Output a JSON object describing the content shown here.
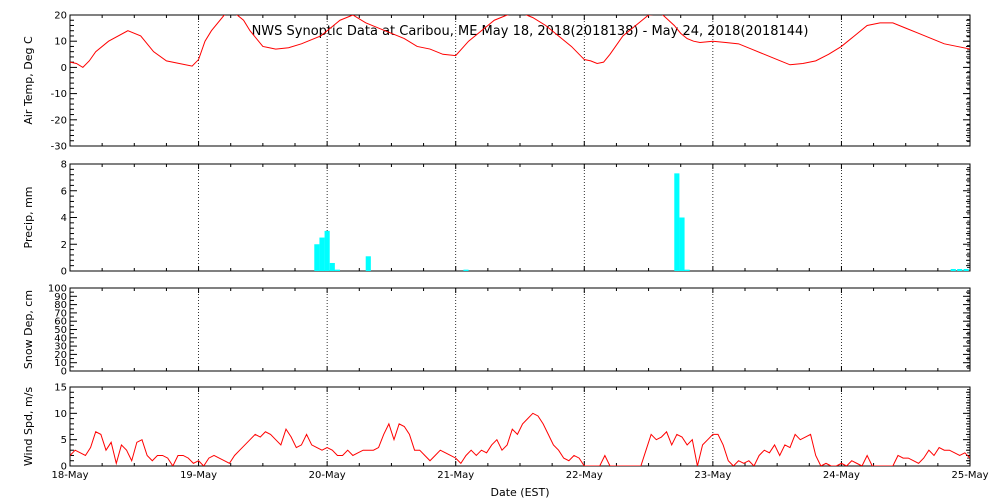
{
  "title": "NWS Synoptic Data at Caribou, ME   May 18, 2018(2018138) - May 24, 2018(2018144)",
  "xlabel": "Date (EST)",
  "colors": {
    "temperature": "#ff0000",
    "precip": "#00ffff",
    "wind": "#ff0000",
    "axis": "#000000",
    "grid": "#000000"
  },
  "chart_data": {
    "type": "multi-panel",
    "x_ticks": [
      "18-May",
      "19-May",
      "20-May",
      "21-May",
      "22-May",
      "23-May",
      "24-May",
      "25-May"
    ],
    "grid": "vertical dotted at day boundaries",
    "panels": [
      {
        "id": "temperature",
        "type": "line",
        "ylabel": "Air Temp, Deg C",
        "ylim": [
          -30,
          20
        ],
        "yticks": [
          "-30",
          "-20",
          "-10",
          "0",
          "10",
          "20"
        ],
        "series": [
          {
            "x": [
              0.0,
              0.05,
              0.1,
              0.15,
              0.2,
              0.3,
              0.45,
              0.55,
              0.65,
              0.75,
              0.85,
              0.95,
              1.0,
              1.05,
              1.1,
              1.2,
              1.25,
              1.3,
              1.35,
              1.4,
              1.5,
              1.55,
              1.6,
              1.7,
              1.8,
              1.9,
              1.95,
              2.0,
              2.05,
              2.1,
              2.15,
              2.2,
              2.3,
              2.45,
              2.6,
              2.7,
              2.8,
              2.9,
              3.0,
              3.1,
              3.15,
              3.2,
              3.25,
              3.3,
              3.4,
              3.5,
              3.6,
              3.7,
              3.8,
              3.9,
              4.0,
              4.05,
              4.1,
              4.15,
              4.2,
              4.3,
              4.4,
              4.5,
              4.6,
              4.7,
              4.75,
              4.8,
              4.85,
              4.9,
              5.0,
              5.1,
              5.2,
              5.3,
              5.4,
              5.5,
              5.6,
              5.7,
              5.8,
              5.9,
              6.0,
              6.05,
              6.1,
              6.15,
              6.2,
              6.3,
              6.4,
              6.5,
              6.6,
              6.7,
              6.8,
              6.9,
              7.0
            ],
            "y": [
              2,
              1.5,
              0,
              2.5,
              6,
              10,
              14,
              12,
              6,
              2.5,
              1.5,
              0.5,
              3,
              10,
              14,
              20,
              21,
              20,
              18,
              14,
              8,
              7.5,
              7,
              7.5,
              9,
              11,
              12,
              14,
              16,
              18,
              19,
              20,
              17,
              14,
              11,
              8,
              7,
              5,
              4.5,
              10,
              12,
              14,
              16,
              18,
              20,
              21,
              19,
              16,
              12,
              8,
              3,
              2.5,
              1.5,
              2,
              5,
              12,
              16,
              20,
              20.5,
              16,
              13,
              11,
              10,
              9.5,
              10,
              9.5,
              9,
              7,
              5,
              3,
              1,
              1.5,
              2.5,
              5,
              8,
              10,
              12,
              14,
              16,
              17,
              17,
              15,
              13,
              11,
              9,
              8,
              7
            ]
          }
        ]
      },
      {
        "id": "precip",
        "type": "bar",
        "ylabel": "Precip, mm",
        "ylim": [
          0,
          8
        ],
        "yticks": [
          "0",
          "2",
          "4",
          "6",
          "8"
        ],
        "series": [
          {
            "x": [
              1.9,
              1.94,
              1.98,
              2.02,
              2.06,
              2.3,
              3.06,
              4.7,
              4.74,
              4.78,
              6.85,
              6.9,
              6.95
            ],
            "values": [
              2,
              2.5,
              3,
              0.6,
              0.1,
              1.1,
              0.1,
              7.3,
              4.0,
              0.1,
              0.15,
              0.15,
              0.15
            ]
          }
        ]
      },
      {
        "id": "snow",
        "type": "line",
        "ylabel": "Snow Dep, cm",
        "ylim": [
          0,
          100
        ],
        "yticks": [
          "0",
          "10",
          "20",
          "30",
          "40",
          "50",
          "60",
          "70",
          "80",
          "90",
          "100"
        ],
        "series": []
      },
      {
        "id": "wind",
        "type": "line",
        "ylabel": "Wind Spd, m/s",
        "ylim": [
          0,
          15
        ],
        "yticks": [
          "0",
          "5",
          "10",
          "15"
        ],
        "series": [
          {
            "x": [
              0.0,
              0.04,
              0.08,
              0.12,
              0.16,
              0.2,
              0.24,
              0.28,
              0.32,
              0.36,
              0.4,
              0.44,
              0.48,
              0.52,
              0.56,
              0.6,
              0.64,
              0.68,
              0.72,
              0.76,
              0.8,
              0.84,
              0.88,
              0.92,
              0.96,
              1.0,
              1.04,
              1.08,
              1.12,
              1.16,
              1.2,
              1.24,
              1.28,
              1.32,
              1.36,
              1.4,
              1.44,
              1.48,
              1.52,
              1.56,
              1.6,
              1.64,
              1.68,
              1.72,
              1.76,
              1.8,
              1.84,
              1.88,
              1.92,
              1.96,
              2.0,
              2.04,
              2.08,
              2.12,
              2.16,
              2.2,
              2.24,
              2.28,
              2.32,
              2.36,
              2.4,
              2.44,
              2.48,
              2.52,
              2.56,
              2.6,
              2.64,
              2.68,
              2.72,
              2.76,
              2.8,
              2.84,
              2.88,
              2.92,
              2.96,
              3.0,
              3.04,
              3.08,
              3.12,
              3.16,
              3.2,
              3.24,
              3.28,
              3.32,
              3.36,
              3.4,
              3.44,
              3.48,
              3.52,
              3.56,
              3.6,
              3.64,
              3.68,
              3.72,
              3.76,
              3.8,
              3.84,
              3.88,
              3.92,
              3.96,
              4.0,
              4.04,
              4.08,
              4.12,
              4.16,
              4.2,
              4.24,
              4.28,
              4.32,
              4.36,
              4.4,
              4.44,
              4.48,
              4.52,
              4.56,
              4.6,
              4.64,
              4.68,
              4.72,
              4.76,
              4.8,
              4.84,
              4.88,
              4.92,
              4.96,
              5.0,
              5.04,
              5.08,
              5.12,
              5.16,
              5.2,
              5.24,
              5.28,
              5.32,
              5.36,
              5.4,
              5.44,
              5.48,
              5.52,
              5.56,
              5.6,
              5.64,
              5.68,
              5.72,
              5.76,
              5.8,
              5.84,
              5.88,
              5.92,
              5.96,
              6.0,
              6.04,
              6.08,
              6.12,
              6.16,
              6.2,
              6.24,
              6.28,
              6.32,
              6.36,
              6.4,
              6.44,
              6.48,
              6.52,
              6.56,
              6.6,
              6.64,
              6.68,
              6.72,
              6.76,
              6.8,
              6.84,
              6.88,
              6.92,
              6.96,
              7.0
            ],
            "y": [
              2,
              3,
              2.5,
              2,
              3.5,
              6.5,
              6,
              3,
              4.5,
              0.5,
              4,
              3,
              1,
              4.5,
              5,
              2,
              1,
              2,
              2,
              1.5,
              0,
              2,
              2,
              1.5,
              0.5,
              1,
              0,
              1.5,
              2,
              1.5,
              1,
              0.5,
              2,
              3,
              4,
              5,
              6,
              5.5,
              6.5,
              6,
              5,
              4,
              7,
              5.5,
              3.5,
              4,
              6,
              4,
              3.5,
              3,
              3.5,
              3,
              2,
              2,
              3,
              2,
              2.5,
              3,
              3,
              3,
              3.5,
              6,
              8,
              5,
              8,
              7.5,
              6,
              3,
              3,
              2,
              1,
              2,
              3,
              2.5,
              2,
              1.5,
              0.5,
              2,
              3,
              2,
              3,
              2.5,
              4,
              5,
              3,
              4,
              7,
              6,
              8,
              9,
              10,
              9.5,
              8,
              6,
              4,
              3,
              1.5,
              1,
              2,
              1.5,
              0,
              0,
              0,
              0,
              2,
              0,
              0,
              0,
              0,
              0,
              0,
              0,
              3,
              6,
              5,
              5.5,
              6.5,
              4,
              6,
              5.5,
              4,
              5,
              0,
              4,
              5,
              6,
              6,
              4,
              1,
              0,
              1,
              0.5,
              1,
              0,
              2,
              3,
              2.5,
              4,
              2,
              4,
              3.5,
              6,
              5,
              5.5,
              6,
              2,
              0,
              0.5,
              0,
              0,
              0.5,
              0,
              1,
              0.5,
              0,
              2,
              0,
              0,
              0,
              0,
              0,
              2,
              1.5,
              1.5,
              1,
              0.5,
              1.5,
              3,
              2,
              3.5,
              3,
              3,
              2.5,
              2,
              2.5,
              1.5,
              2,
              2.5,
              3,
              1.5,
              2
            ]
          }
        ]
      }
    ]
  }
}
